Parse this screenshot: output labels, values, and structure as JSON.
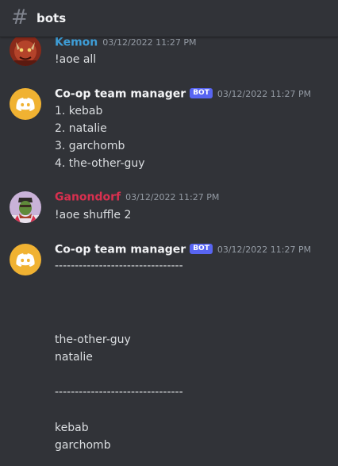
{
  "channel": {
    "name": "bots",
    "icon": "hash-icon"
  },
  "colors": {
    "background": "#313338",
    "text": "#dbdee1",
    "muted": "#949ba4",
    "bot_tag": "#5865f2",
    "kemon": "#3e9dd6",
    "ganondorf": "#d9304f",
    "bot_name": "#f2f3f5",
    "bot_avatar": "#f0b232"
  },
  "messages": [
    {
      "author": "Kemon",
      "timestamp": "03/12/2022 11:27 PM",
      "is_bot": false,
      "lines": [
        "!aoe all"
      ]
    },
    {
      "author": "Co-op team manager",
      "bot_tag": "BOT",
      "timestamp": "03/12/2022 11:27 PM",
      "is_bot": true,
      "lines": [
        "1. kebab",
        "2. natalie",
        "3. garchomb",
        "4. the-other-guy"
      ]
    },
    {
      "author": "Ganondorf",
      "timestamp": "03/12/2022 11:27 PM",
      "is_bot": false,
      "lines": [
        "!aoe shuffle 2"
      ]
    },
    {
      "author": "Co-op team manager",
      "bot_tag": "BOT",
      "timestamp": "03/12/2022 11:27 PM",
      "is_bot": true,
      "lines": [
        "--------------------------------",
        "",
        "the-other-guy",
        "natalie",
        "",
        "--------------------------------",
        "",
        "kebab",
        "garchomb",
        "",
        "--------------------------------"
      ]
    }
  ]
}
